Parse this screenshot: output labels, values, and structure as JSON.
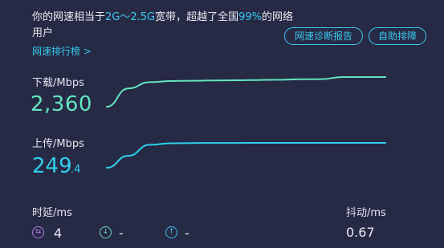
{
  "header": {
    "prefix": "你的网速相当于",
    "bandwidth": "2G～2.5G",
    "middle": "宽带，超越了全国",
    "percent": "99%",
    "suffix": "的网络用户"
  },
  "links": {
    "rank": "网速排行榜 >"
  },
  "buttons": {
    "diagnose": "网速诊断报告",
    "self_fix": "自助排障"
  },
  "download": {
    "label": "下载/Mbps",
    "value": "2,360",
    "color": "#63e4c0"
  },
  "upload": {
    "label": "上传/Mbps",
    "value_main": "249",
    "value_decimal": ".4",
    "color": "#2fd1ee"
  },
  "latency": {
    "title": "时延/ms",
    "ping": {
      "icon": "swap-arrows-icon",
      "value": "4"
    },
    "download": {
      "icon": "arrow-down-icon",
      "value": "-"
    },
    "upload": {
      "icon": "arrow-up-icon",
      "value": "-"
    }
  },
  "jitter": {
    "title": "抖动/ms",
    "value": "0.67"
  },
  "chart_data": {
    "type": "line",
    "series": [
      {
        "values": [
          0,
          1600,
          2150,
          2250,
          2280,
          2300,
          2320,
          2340,
          2360,
          2400,
          2420,
          2600,
          2600,
          2600
        ]
      },
      {
        "values": [
          0,
          120,
          230,
          245,
          247,
          248,
          248,
          249,
          249,
          249,
          249,
          249,
          249,
          249
        ]
      }
    ]
  }
}
